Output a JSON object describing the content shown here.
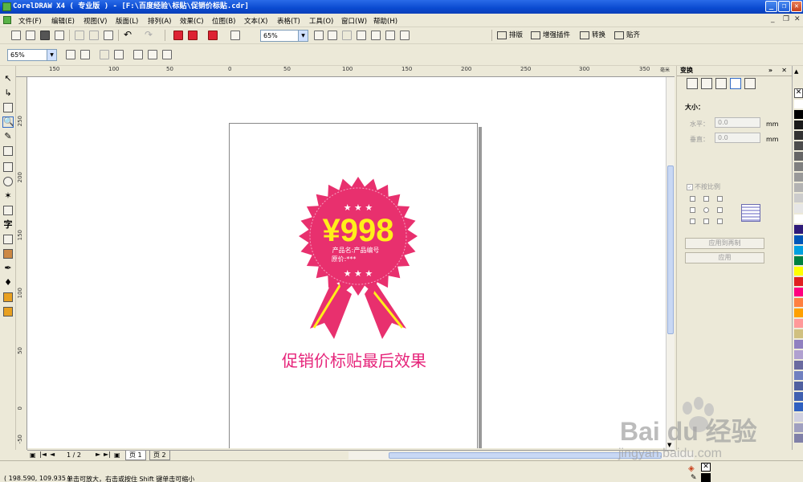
{
  "window": {
    "title": "CorelDRAW X4 ( 专业版 ) - [F:\\百度经验\\标贴\\促销价标贴.cdr]"
  },
  "menu": [
    "文件(F)",
    "编辑(E)",
    "视图(V)",
    "版面(L)",
    "排列(A)",
    "效果(C)",
    "位图(B)",
    "文本(X)",
    "表格(T)",
    "工具(O)",
    "窗口(W)",
    "帮助(H)"
  ],
  "toolbar": {
    "zoom_value": "65%",
    "plugins": [
      "排版",
      "增强插件",
      "转换",
      "贴齐"
    ]
  },
  "propertybar": {
    "zoom_value": "65%"
  },
  "ruler": {
    "h_labels": [
      "150",
      "100",
      "50",
      "0",
      "50",
      "100",
      "150",
      "200",
      "250",
      "300",
      "350"
    ],
    "h_unit": "毫米",
    "v_labels": [
      "250",
      "200",
      "150",
      "100",
      "50",
      "0",
      "-50"
    ]
  },
  "artwork": {
    "price": "¥998",
    "line1": "产品名:产品编号",
    "line2": "原价:***",
    "caption": "促销价标贴最后效果",
    "badge_color": "#e8306e",
    "price_color": "#ffef1a"
  },
  "pages": {
    "indicator": "1 / 2",
    "tabs": [
      "页 1",
      "页 2"
    ]
  },
  "docker": {
    "title": "变换",
    "size_label": "大小：",
    "h_label": "水平：",
    "h_value": "0.0",
    "v_label": "垂直：",
    "v_value": "0.0",
    "unit": "mm",
    "proportional_label": "不按比例",
    "apply_dup_label": "应用到再制",
    "apply_label": "应用"
  },
  "palette": [
    "#ffffff",
    "#000000",
    "#1a1a1a",
    "#333333",
    "#4d4d4d",
    "#666666",
    "#808080",
    "#999999",
    "#b3b3b3",
    "#cccccc",
    "#e6e6e6",
    "#ffffff",
    "#2e1a7a",
    "#0057b8",
    "#00a0e0",
    "#008040",
    "#ffff00",
    "#e02020",
    "#ff0080",
    "#ff8040",
    "#ffa000",
    "#ff9999",
    "#d0c080",
    "#9080c0",
    "#b0a0d0",
    "#6a6aa0",
    "#7080c0",
    "#5060a0",
    "#4060b0",
    "#3060c0",
    "#d0d0e0",
    "#a0a0c0",
    "#8080a8"
  ],
  "status": {
    "coords": "( 198.590, 109.935 )",
    "hint": "单击可放大，右击或按住 Shift 键单击可缩小"
  },
  "watermark": {
    "brand": "Bai du 经验",
    "url": "jingyan.baidu.com"
  }
}
